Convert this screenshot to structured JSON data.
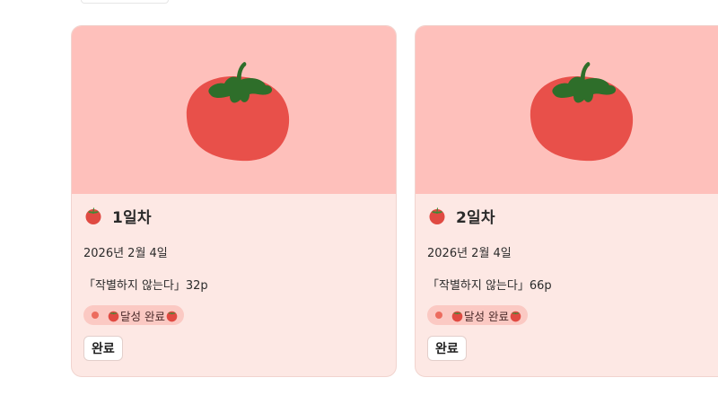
{
  "cards": [
    {
      "title": "1일차",
      "date": "2026년 2월 4일",
      "book": "「작별하지 않는다」32p",
      "badge_label": "달성 완료",
      "button_label": "완료"
    },
    {
      "title": "2일차",
      "date": "2026년 2월 4일",
      "book": "「작별하지 않는다」66p",
      "badge_label": "달성 완료",
      "button_label": "완료"
    }
  ],
  "colors": {
    "cover_bg": "#fec0bb",
    "card_bg": "#fde8e4",
    "tomato": "#e8504a",
    "leaf": "#2e6e2a",
    "badge_bg": "#fbc9c3"
  },
  "icons": {
    "cover": "tomato-illustration",
    "title": "tomato-icon",
    "badge_dot": "status-dot-icon"
  }
}
